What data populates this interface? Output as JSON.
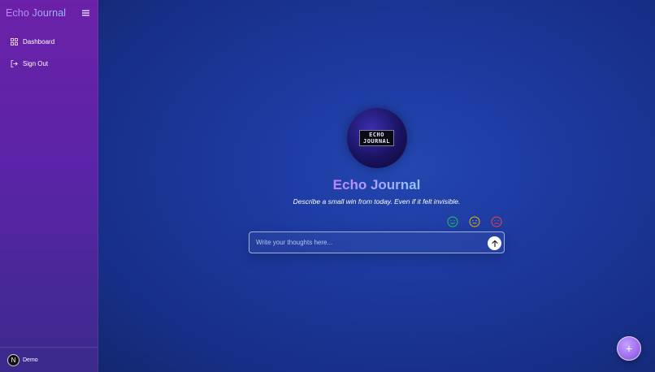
{
  "sidebar": {
    "brand": "Echo Journal",
    "menu_icon": "hamburger-icon",
    "items": [
      {
        "label": "Dashboard",
        "icon": "grid-icon"
      },
      {
        "label": "Sign Out",
        "icon": "logout-icon"
      }
    ],
    "user": {
      "avatar_letter": "N",
      "name": "Demo"
    }
  },
  "main": {
    "logo": {
      "line1": "ECHO",
      "line2": "JOURNAL"
    },
    "title": "Echo Journal",
    "prompt": "Describe a small win from today. Even if it felt invisible.",
    "moods": [
      {
        "icon": "smile-icon",
        "color": "#22c55e"
      },
      {
        "icon": "neutral-icon",
        "color": "#eab308"
      },
      {
        "icon": "frown-icon",
        "color": "#ef4444"
      }
    ],
    "input": {
      "placeholder": "Write your thoughts here...",
      "value": ""
    },
    "send_icon": "arrow-up-icon",
    "fab_label": "+"
  },
  "colors": {
    "accent_purple": "#c084fc",
    "accent_blue": "#93c5fd",
    "sidebar_top": "#6b21a8",
    "main_bg": "#1d3aa0"
  }
}
